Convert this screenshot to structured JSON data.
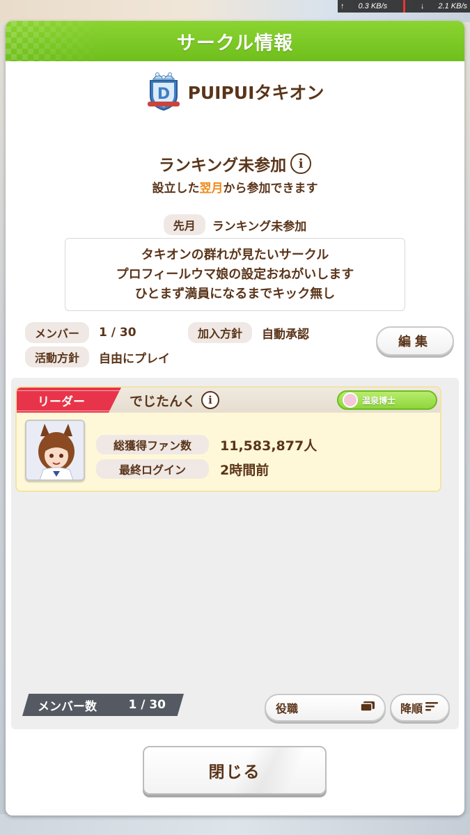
{
  "status_bar": {
    "up_arrow": "↑",
    "up_speed": "0.3 KB/s",
    "down_arrow": "↓",
    "down_speed": "2.1 KB/s"
  },
  "dialog": {
    "title": "サークル情報"
  },
  "circle": {
    "rank_letter": "D",
    "name": "PUIPUIタキオン"
  },
  "ranking": {
    "title": "ランキング未参加",
    "info_icon": "i",
    "sub_prefix": "設立した",
    "sub_highlight": "翌月",
    "sub_suffix": "から参加できます",
    "last_month_label": "先月",
    "last_month_value": "ランキング未参加"
  },
  "description": {
    "lines": [
      "タキオンの群れが見たいサークル",
      "プロフィールウマ娘の設定おねがいします",
      "ひとまず満員になるまでキック無し"
    ]
  },
  "info": {
    "members_label": "メンバー",
    "members_value": "1 / 30",
    "join_policy_label": "加入方針",
    "join_policy_value": "自動承認",
    "activity_label": "活動方針",
    "activity_value": "自由にプレイ",
    "edit_label": "編集"
  },
  "member": {
    "role_tag": "リーダー",
    "name": "でじたんく",
    "info_icon": "i",
    "title_badge": "温泉博士",
    "fans_label": "総獲得ファン数",
    "fans_value": "11,583,877人",
    "login_label": "最終ログイン",
    "login_value": "2時間前"
  },
  "member_list": {
    "count_label": "メンバー数",
    "count_value": "1 / 30",
    "sort_label": "役職",
    "order_label": "降順"
  },
  "close_label": "閉じる",
  "colors": {
    "header_green": "#7ac928",
    "text_brown": "#5a3419",
    "highlight_orange": "#f08a1c",
    "leader_red": "#e8344a",
    "card_yellow": "#fff8d8"
  }
}
